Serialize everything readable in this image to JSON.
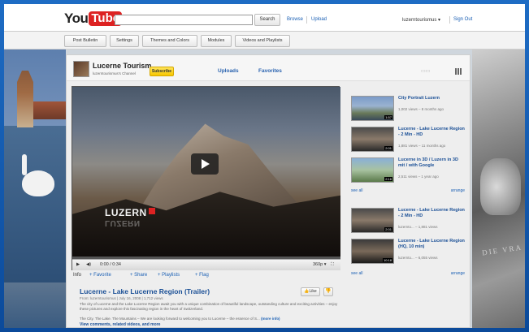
{
  "header": {
    "logo_you": "You",
    "logo_tube": "Tube",
    "search_button": "Search",
    "browse": "Browse",
    "upload": "Upload",
    "username": "luzerntourismus",
    "sign_out": "Sign Out"
  },
  "tabs": [
    "Post Bulletin",
    "Settings",
    "Themes and Colors",
    "Modules",
    "Videos and Playlists"
  ],
  "channel": {
    "name": "Lucerne Tourism",
    "subtitle": "luzerntourismus's Channel",
    "subscribe": "Subscribe",
    "nav": [
      "Uploads",
      "Favorites"
    ]
  },
  "player": {
    "time": "0:00 / 0:34",
    "quality": "360p",
    "watermark": "LUZERN",
    "watermark_reflection": "LUZERN"
  },
  "actions": {
    "info": "Info",
    "favorite": "Favorite",
    "share": "Share",
    "playlists": "Playlists",
    "flag": "Flag"
  },
  "video": {
    "title": "Lucerne - Lake Lucerne Region (Trailer)",
    "meta": "From: luzerntourismus | July 16, 2008 | 1,712 views",
    "description": "The city of Lucerne and the Lake Lucerne Region await you with a unique combination of beautiful landscape, outstanding culture and exciting activities – enjoy these pictures and explore this fascinating region in the heart of Switzerland.",
    "description2": "The City. The Lake. The Mountains – We are looking forward to welcoming you to Lucerne – the essence of S...",
    "more_info": "(more info)",
    "more_link": "View comments, related videos, and more",
    "like": "Like"
  },
  "list_top": [
    {
      "title": "City Portrait Luzern",
      "meta": "1,002 views – 8 months ago",
      "duration": "1:57"
    },
    {
      "title": "Lucerne - Lake Lucerne Region - 2 Min - HD",
      "meta": "1,881 views – 11 months ago",
      "duration": "2:01"
    },
    {
      "title": "Lucerne in 3D / Luzern in 3D mit / with Google",
      "meta": "2,511 views – 1 year ago",
      "duration": "2:16"
    }
  ],
  "list_bottom": [
    {
      "title": "Lucerne - Lake Lucerne Region - 2 Min - HD",
      "meta": "luzernto... – 1,881 views",
      "duration": "2:01"
    },
    {
      "title": "Lucerne - Lake Lucerne Region (HQ, 10 min)",
      "meta": "luzernto... – 6,055 views",
      "duration": "10:18"
    }
  ],
  "list_links": {
    "see_all": "see all",
    "arrange": "arrange"
  },
  "background": {
    "carved_text": "DIE VRA"
  },
  "colors": {
    "frame": "#0d4f9c",
    "link": "#1a5fb4",
    "subscribe": "#f7c600",
    "logo_red": "#dd2222"
  }
}
